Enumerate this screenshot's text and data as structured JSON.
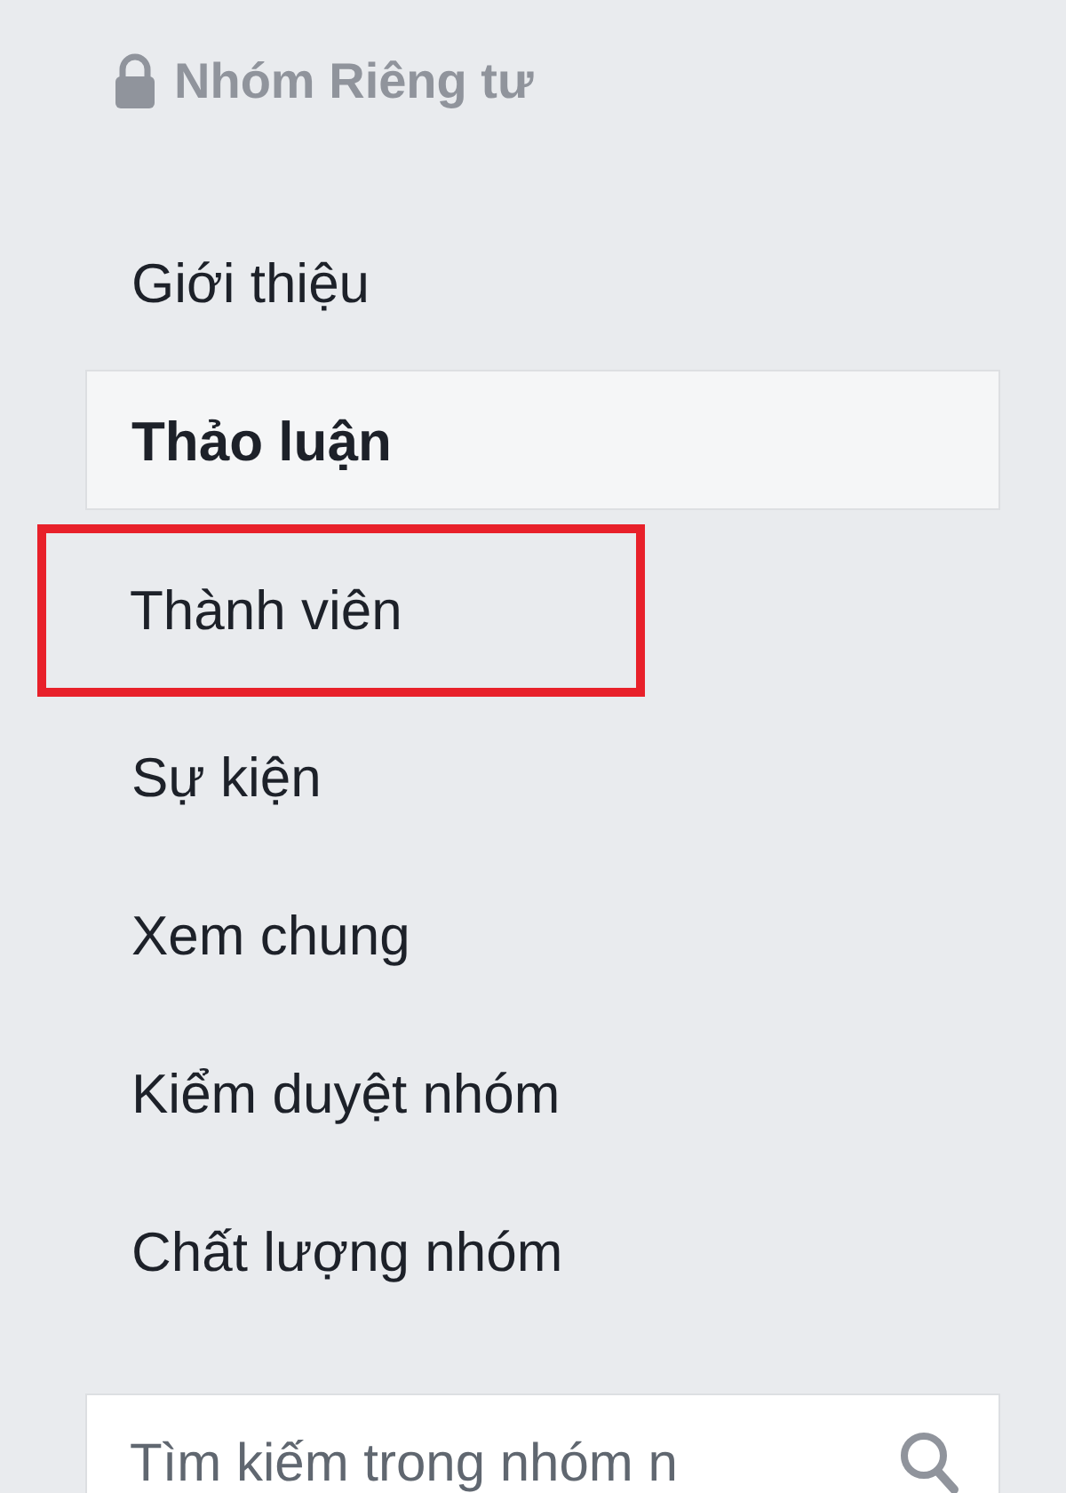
{
  "header": {
    "title": "Nhóm Riêng tư"
  },
  "nav": [
    {
      "label": "Giới thiệu",
      "selected": false,
      "highlighted": false
    },
    {
      "label": "Thảo luận",
      "selected": true,
      "highlighted": false
    },
    {
      "label": "Thành viên",
      "selected": false,
      "highlighted": true
    },
    {
      "label": "Sự kiện",
      "selected": false,
      "highlighted": false
    },
    {
      "label": "Xem chung",
      "selected": false,
      "highlighted": false
    },
    {
      "label": "Kiểm duyệt nhóm",
      "selected": false,
      "highlighted": false
    },
    {
      "label": "Chất lượng nhóm",
      "selected": false,
      "highlighted": false
    }
  ],
  "search": {
    "placeholder": "Tìm kiếm trong nhóm n"
  }
}
